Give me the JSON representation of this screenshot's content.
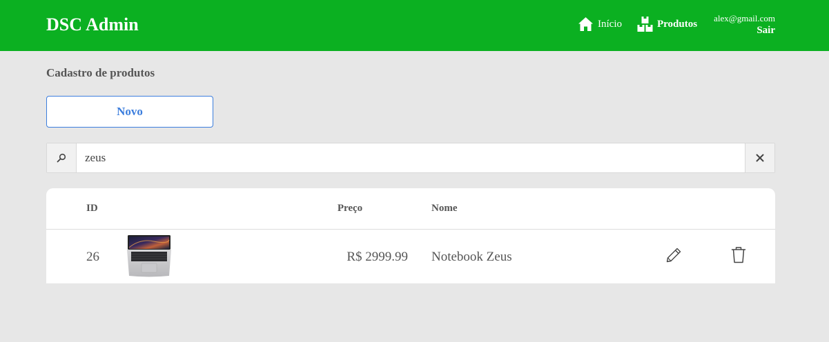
{
  "navbar": {
    "brand": "DSC Admin",
    "links": [
      {
        "label": "Início",
        "icon": "home-icon"
      },
      {
        "label": "Produtos",
        "icon": "boxes-icon"
      }
    ],
    "user_email": "alex@gmail.com",
    "logout_label": "Sair"
  },
  "colors": {
    "navbar": "#0bb021",
    "background": "#e7e7e7",
    "primary": "#3b7ddd"
  },
  "page": {
    "title": "Cadastro de produtos",
    "new_button_label": "Novo"
  },
  "search": {
    "value": "zeus",
    "search_icon": "search-icon",
    "clear_icon": "close-icon"
  },
  "table": {
    "headers": {
      "id": "ID",
      "price": "Preço",
      "name": "Nome"
    },
    "rows": [
      {
        "id": "26",
        "image": "laptop-thumbnail",
        "price": "R$ 2999.99",
        "name": "Notebook Zeus",
        "edit_icon": "pencil-icon",
        "delete_icon": "trash-icon"
      }
    ]
  }
}
